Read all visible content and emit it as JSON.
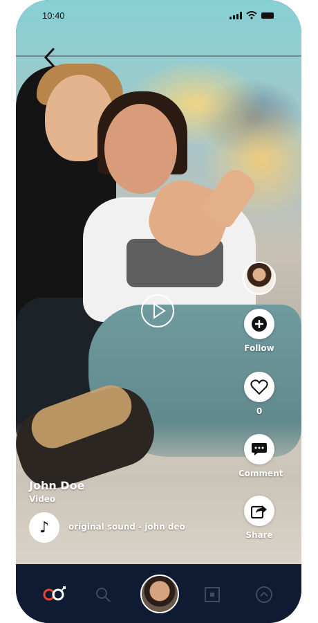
{
  "status_bar": {
    "time": "10:40"
  },
  "video": {
    "play_icon": "play-icon"
  },
  "actions": {
    "follow_label": "Follow",
    "like_count": "0",
    "comment_label": "Comment",
    "share_label": "Share"
  },
  "post": {
    "username": "John Doe",
    "subtitle": "Video",
    "sound": "original sound - john deo"
  },
  "nav": {
    "items": [
      "home-icon",
      "search-icon",
      "profile-avatar",
      "scan-icon",
      "chevron-up-icon"
    ],
    "accent": "#e8462d"
  }
}
